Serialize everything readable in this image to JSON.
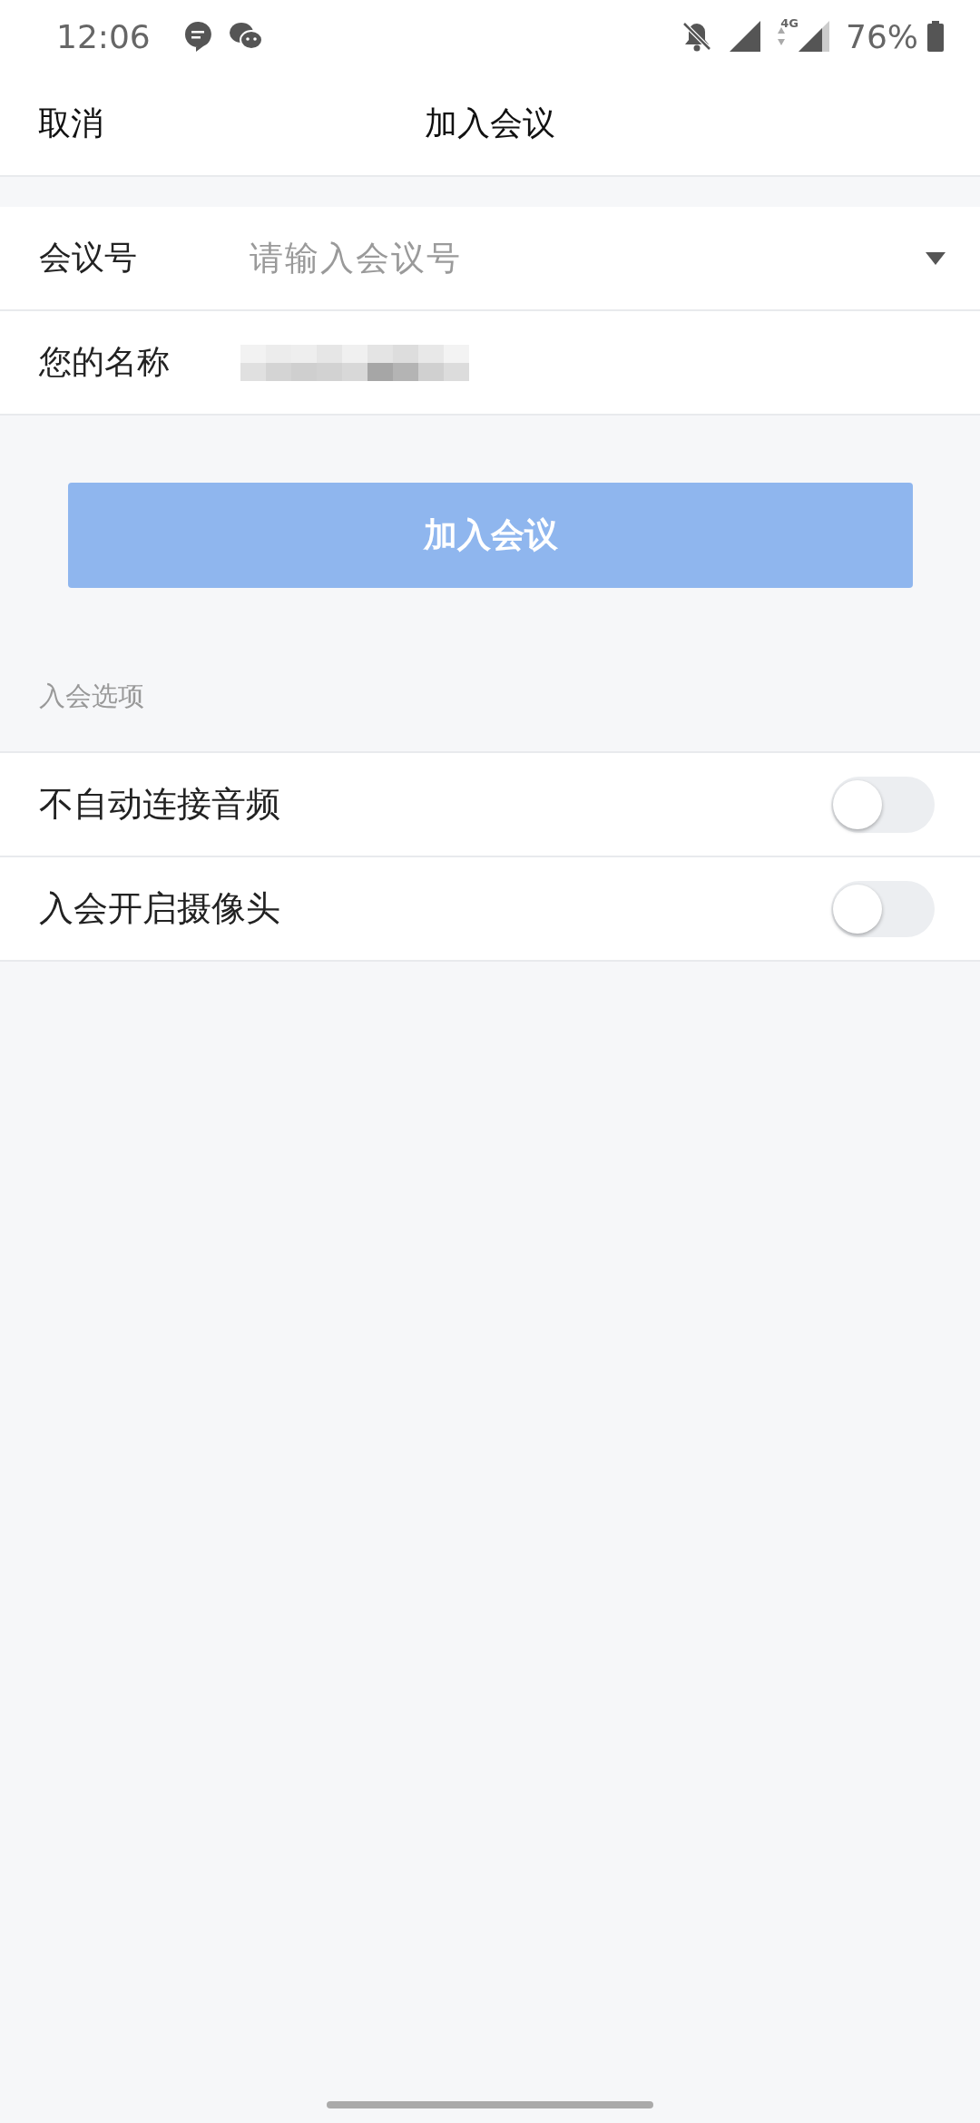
{
  "status_bar": {
    "time": "12:06",
    "network": "4G",
    "battery": "76%"
  },
  "header": {
    "cancel": "取消",
    "title": "加入会议"
  },
  "fields": [
    {
      "kind": "dropdown",
      "label": "会议号",
      "placeholder": "请输入会议号"
    },
    {
      "kind": "redacted",
      "label": "您的名称"
    }
  ],
  "join_button": {
    "label": "加入会议",
    "disabled": true
  },
  "options_title": "入会选项",
  "options": [
    {
      "label": "不自动连接音频",
      "on": false
    },
    {
      "label": "入会开启摄像头",
      "on": false
    }
  ]
}
